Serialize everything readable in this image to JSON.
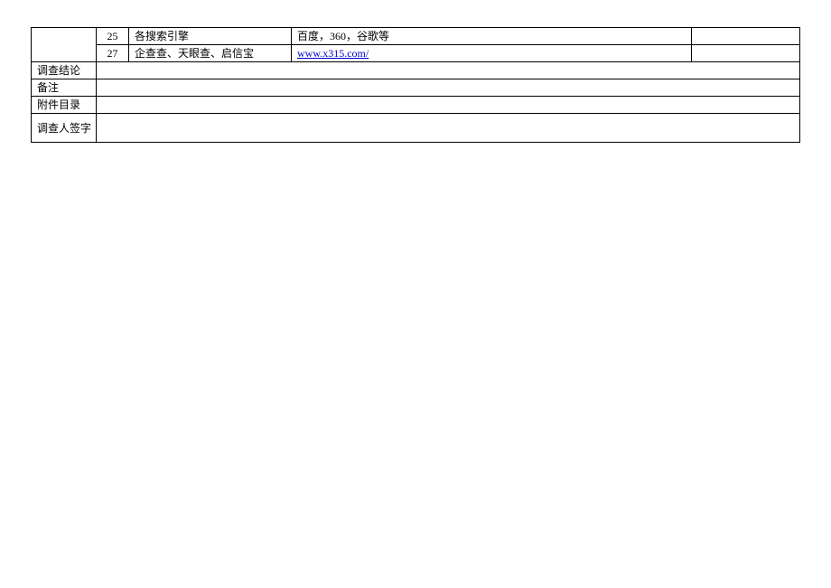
{
  "rows": [
    {
      "num": "25",
      "desc": "各搜索引擎",
      "content": "百度，360，谷歌等",
      "isLink": false
    },
    {
      "num": "27",
      "desc": "企查查、天眼查、启信宝",
      "content": "www.x315.com/",
      "isLink": true
    }
  ],
  "labels": {
    "conclusion": "调查结论",
    "remarks": "备注",
    "attachments": "附件目录",
    "signature": "调查人签字"
  }
}
